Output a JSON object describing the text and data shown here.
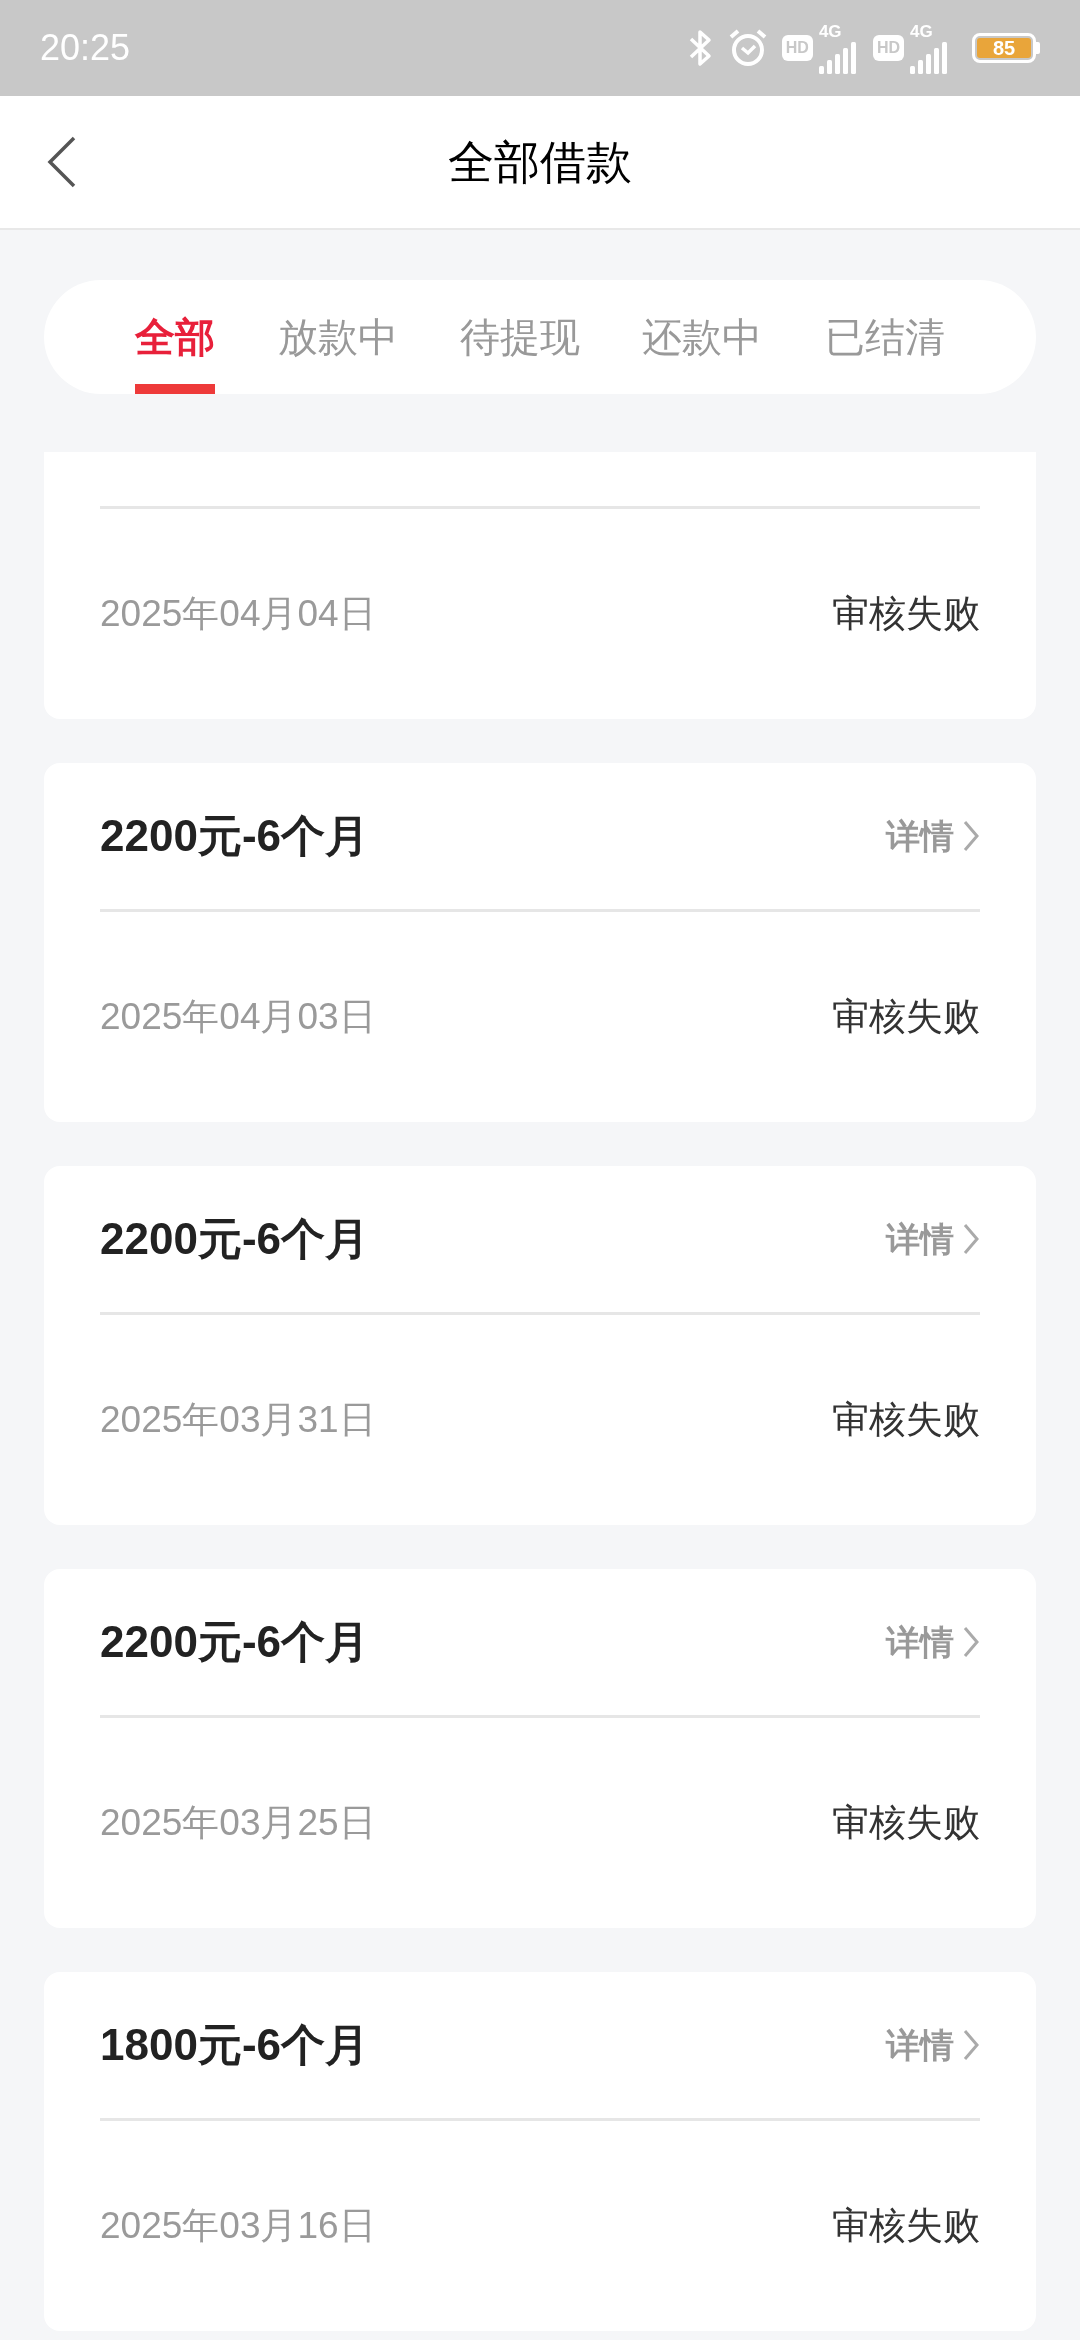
{
  "status_bar": {
    "time": "20:25",
    "sims": [
      {
        "hd": "HD",
        "network": "4G"
      },
      {
        "hd": "HD",
        "network": "4G"
      }
    ],
    "battery": "85"
  },
  "header": {
    "title": "全部借款"
  },
  "tabs": [
    {
      "label": "全部",
      "selected": true
    },
    {
      "label": "放款中",
      "selected": false
    },
    {
      "label": "待提现",
      "selected": false
    },
    {
      "label": "还款中",
      "selected": false
    },
    {
      "label": "已结清",
      "selected": false
    }
  ],
  "loans": [
    {
      "kind": "partial",
      "date": "2025年04月04日",
      "status": "审核失败"
    },
    {
      "kind": "full",
      "title": "2200元-6个月",
      "detail": "详情",
      "date": "2025年04月03日",
      "status": "审核失败"
    },
    {
      "kind": "full",
      "title": "2200元-6个月",
      "detail": "详情",
      "date": "2025年03月31日",
      "status": "审核失败"
    },
    {
      "kind": "full",
      "title": "2200元-6个月",
      "detail": "详情",
      "date": "2025年03月25日",
      "status": "审核失败"
    },
    {
      "kind": "full",
      "title": "1800元-6个月",
      "detail": "详情",
      "date": "2025年03月16日",
      "status": "审核失败"
    }
  ]
}
